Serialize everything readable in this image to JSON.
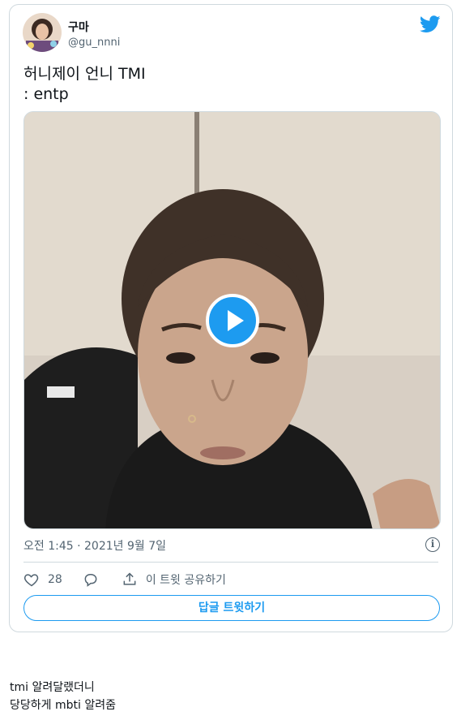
{
  "tweet": {
    "display_name": "구마",
    "handle": "@gu_nnni",
    "text_line1": "허니제이 언니 TMI",
    "text_line2": ": entp",
    "timestamp": "오전 1:45 · 2021년 9월 7일",
    "like_count": "28",
    "share_label": "이 트윗 공유하기",
    "reply_button": "답글 트윗하기"
  },
  "caption": {
    "line1": "tmi 알려달랬더니",
    "line2": "당당하게 mbti 알려줌"
  },
  "colors": {
    "accent": "#1d9bf0",
    "border": "#cfd9de",
    "muted": "#536471"
  },
  "icons": [
    "twitter-bird-icon",
    "play-icon",
    "info-icon",
    "heart-icon",
    "reply-icon",
    "share-icon"
  ]
}
